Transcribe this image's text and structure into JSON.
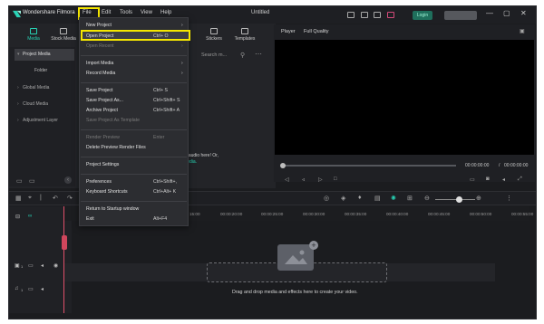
{
  "titlebar": {
    "app_name": "Wondershare Filmora",
    "menu": [
      "File",
      "Edit",
      "Tools",
      "View",
      "Help"
    ],
    "doc_title": "Untitled",
    "login_label": "Login",
    "window_controls": [
      "—",
      "▢",
      "✕"
    ]
  },
  "media_panel": {
    "tabs": [
      {
        "label": "Media",
        "icon": "media-icon"
      },
      {
        "label": "Stock Media",
        "icon": "stock-media-icon"
      },
      {
        "label": "Stickers",
        "icon": "stickers-icon"
      },
      {
        "label": "Templates",
        "icon": "templates-icon"
      }
    ],
    "sidebar": [
      {
        "label": "Project Media"
      },
      {
        "label": "Folder"
      },
      {
        "label": "Global Media"
      },
      {
        "label": "Cloud Media"
      },
      {
        "label": "Adjustment Layer"
      }
    ],
    "search_placeholder": "Search m...",
    "import_hint_line1": "or audio here! Or,",
    "import_hint_link": "media."
  },
  "player": {
    "label": "Player",
    "quality": "Full Quality",
    "time_current": "00:00:00:00",
    "time_sep": "/",
    "time_total": "00:00:00:00"
  },
  "timeline": {
    "ruler": [
      "00:00:15:00",
      "00:00:20:00",
      "00:00:25:00",
      "00:00:30:00",
      "00:00:35:00",
      "00:00:40:00",
      "00:00:45:00",
      "00:00:50:00",
      "00:00:55:00"
    ],
    "ruler_first": "15:00",
    "drop_text": "Drag and drop media and effects here to create your video.",
    "video_track_num": "1",
    "audio_track_num": "1"
  },
  "file_menu": {
    "items": [
      {
        "label": "New Project",
        "shortcut": "",
        "arrow": true,
        "disabled": false
      },
      {
        "label": "Open Project",
        "shortcut": "Ctrl+ O",
        "arrow": false,
        "disabled": false,
        "highlighted": true
      },
      {
        "label": "Open Recent",
        "shortcut": "",
        "arrow": true,
        "disabled": true
      },
      {
        "label": "Import Media",
        "shortcut": "",
        "arrow": true,
        "disabled": false
      },
      {
        "label": "Record Media",
        "shortcut": "",
        "arrow": true,
        "disabled": false
      },
      {
        "label": "Save Project",
        "shortcut": "Ctrl+ S",
        "arrow": false,
        "disabled": false
      },
      {
        "label": "Save Project As...",
        "shortcut": "Ctrl+Shift+ S",
        "arrow": false,
        "disabled": false
      },
      {
        "label": "Archive Project",
        "shortcut": "Ctrl+Shift+ A",
        "arrow": false,
        "disabled": false
      },
      {
        "label": "Save Project As Template",
        "shortcut": "",
        "arrow": false,
        "disabled": true
      },
      {
        "label": "Render Preview",
        "shortcut": "Enter",
        "arrow": false,
        "disabled": true
      },
      {
        "label": "Delete Preview Render Files",
        "shortcut": "",
        "arrow": false,
        "disabled": false
      },
      {
        "label": "Project Settings",
        "shortcut": "",
        "arrow": false,
        "disabled": false
      },
      {
        "label": "Preferences",
        "shortcut": "Ctrl+Shift+,",
        "arrow": false,
        "disabled": false
      },
      {
        "label": "Keyboard Shortcuts",
        "shortcut": "Ctrl+Alt+ K",
        "arrow": false,
        "disabled": false
      },
      {
        "label": "Return to Startup window",
        "shortcut": "",
        "arrow": false,
        "disabled": false
      },
      {
        "label": "Exit",
        "shortcut": "Alt+F4",
        "arrow": false,
        "disabled": false
      }
    ]
  },
  "colors": {
    "accent": "#27d2b4",
    "highlight_outline": "#f5e600",
    "playhead": "#e0506a"
  }
}
